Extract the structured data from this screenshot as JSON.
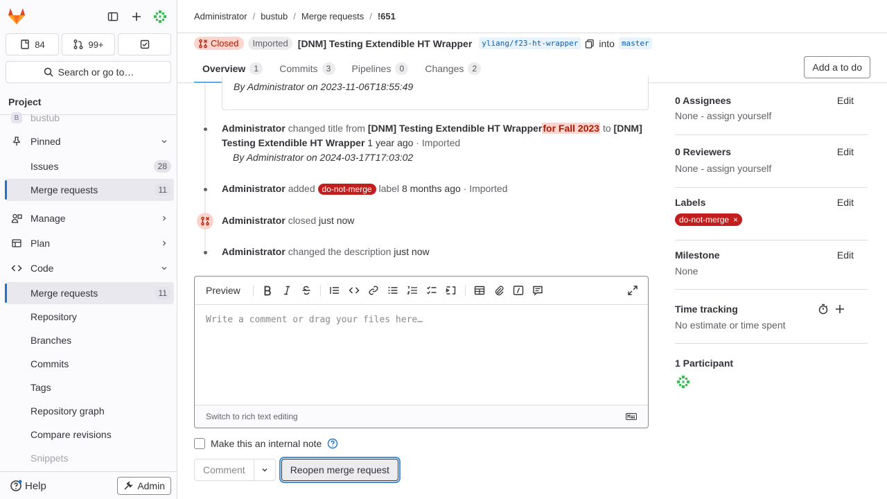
{
  "sidebar": {
    "counts": {
      "issues": "84",
      "merge_requests": "99+"
    },
    "search_label": "Search or go to…",
    "section_title": "Project",
    "project_name": "bustub",
    "pinned": {
      "label": "Pinned",
      "items": [
        {
          "label": "Issues",
          "count": "28"
        },
        {
          "label": "Merge requests",
          "count": "11"
        }
      ]
    },
    "groups": {
      "manage": "Manage",
      "plan": "Plan",
      "code": "Code"
    },
    "code_items": [
      {
        "label": "Merge requests",
        "count": "11"
      },
      {
        "label": "Repository"
      },
      {
        "label": "Branches"
      },
      {
        "label": "Commits"
      },
      {
        "label": "Tags"
      },
      {
        "label": "Repository graph"
      },
      {
        "label": "Compare revisions"
      },
      {
        "label": "Snippets"
      }
    ],
    "help": "Help",
    "admin": "Admin"
  },
  "breadcrumb": [
    "Administrator",
    "bustub",
    "Merge requests",
    "!651"
  ],
  "header": {
    "status": "Closed",
    "imported": "Imported",
    "title": "[DNM] Testing Extendible HT Wrapper",
    "source_branch": "yliang/f23-ht-wrapper",
    "into": "into",
    "target_branch": "master",
    "todo_button": "Add a to do"
  },
  "tabs": [
    {
      "label": "Overview",
      "count": "1"
    },
    {
      "label": "Commits",
      "count": "3"
    },
    {
      "label": "Pipelines",
      "count": "0"
    },
    {
      "label": "Changes",
      "count": "2"
    }
  ],
  "timeline": {
    "prev_by": "By Administrator on 2023-11-06T18:55:49",
    "ev1": {
      "author": "Administrator",
      "action": "changed title from",
      "old_title": "[DNM] Testing Extendible HT Wrapper",
      "removed": "for Fall 2023",
      "to": "to",
      "new_title": "[DNM] Testing Extendible HT Wrapper",
      "time": "1 year ago",
      "imported": "· Imported",
      "by": "By Administrator on 2024-03-17T17:03:02"
    },
    "ev2": {
      "author": "Administrator",
      "action": "added",
      "label": "do-not-merge",
      "suffix": "label",
      "time": "8 months ago",
      "imported": "· Imported"
    },
    "ev3": {
      "author": "Administrator",
      "action": "closed",
      "time": "just now"
    },
    "ev4": {
      "author": "Administrator",
      "action": "changed the description",
      "time": "just now"
    }
  },
  "editor": {
    "preview": "Preview",
    "placeholder": "Write a comment or drag your files here…",
    "switch": "Switch to rich text editing",
    "internal_note": "Make this an internal note",
    "comment": "Comment",
    "reopen": "Reopen merge request"
  },
  "right": {
    "assignees": {
      "title": "0 Assignees",
      "edit": "Edit",
      "value": "None - assign yourself"
    },
    "reviewers": {
      "title": "0 Reviewers",
      "edit": "Edit",
      "value": "None - assign yourself"
    },
    "labels": {
      "title": "Labels",
      "edit": "Edit",
      "chip": "do-not-merge"
    },
    "milestone": {
      "title": "Milestone",
      "edit": "Edit",
      "value": "None"
    },
    "time": {
      "title": "Time tracking",
      "value": "No estimate or time spent"
    },
    "participants": {
      "title": "1 Participant"
    }
  },
  "colors": {
    "accent": "#1f75cb",
    "closed_bg": "#fdd4cd",
    "closed_fg": "#ae1800",
    "label_red": "#c21e1e"
  }
}
